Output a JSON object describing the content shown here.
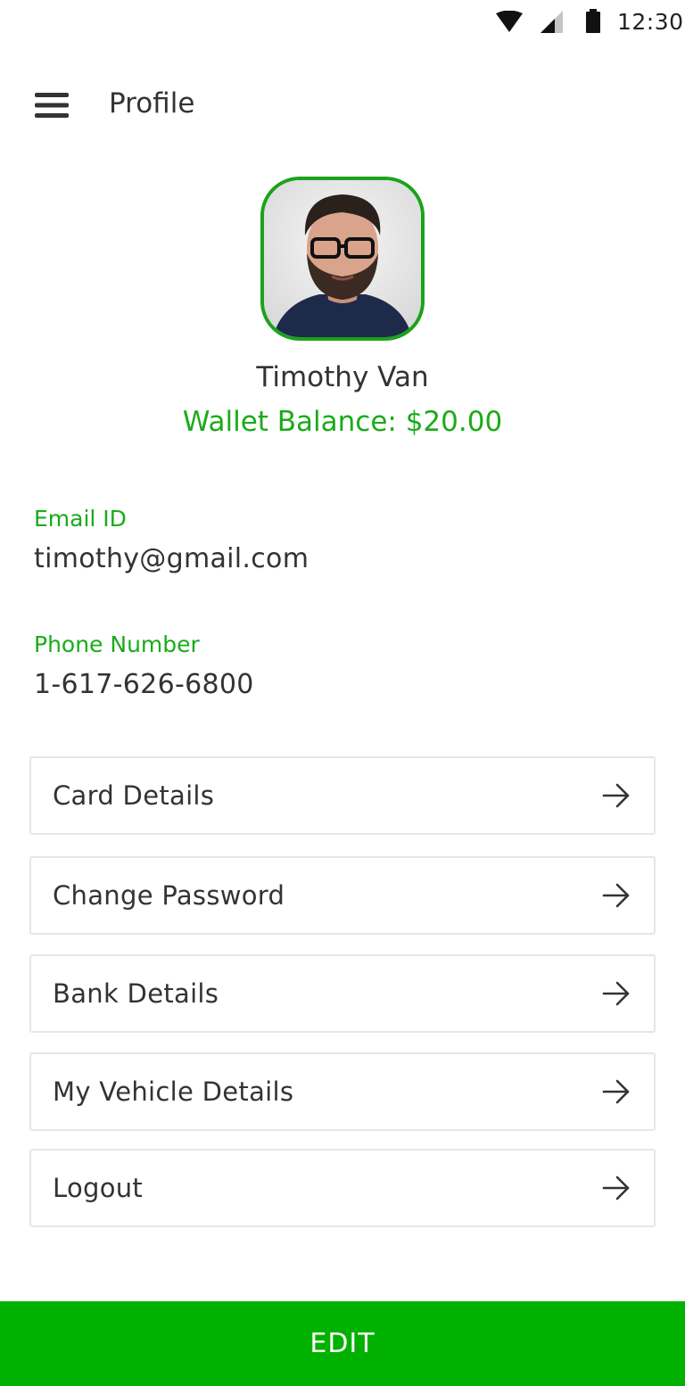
{
  "status_bar": {
    "time": "12:30",
    "icons": [
      "wifi-icon",
      "signal-icon",
      "battery-icon"
    ]
  },
  "app_bar": {
    "menu_icon": "hamburger-menu-icon",
    "title": "Profile"
  },
  "profile": {
    "avatar": "user-avatar-photo",
    "name": "Timothy Van",
    "wallet_balance": "Wallet Balance: $20.00"
  },
  "fields": {
    "email": {
      "label": "Email ID",
      "value": "timothy@gmail.com"
    },
    "phone": {
      "label": "Phone Number",
      "value": "1-617-626-6800"
    }
  },
  "menu": {
    "items": [
      {
        "label": "Card Details",
        "icon": "arrow-right-icon"
      },
      {
        "label": "Change Password",
        "icon": "arrow-right-icon"
      },
      {
        "label": "Bank Details",
        "icon": "arrow-right-icon"
      },
      {
        "label": "My Vehicle Details",
        "icon": "arrow-right-icon"
      },
      {
        "label": "Logout",
        "icon": "arrow-right-icon"
      }
    ]
  },
  "actions": {
    "edit_label": "EDIT"
  },
  "colors": {
    "accent": "#00b100",
    "accent_text": "#1aab1a",
    "text": "#333333",
    "border": "#e6e6e6"
  }
}
